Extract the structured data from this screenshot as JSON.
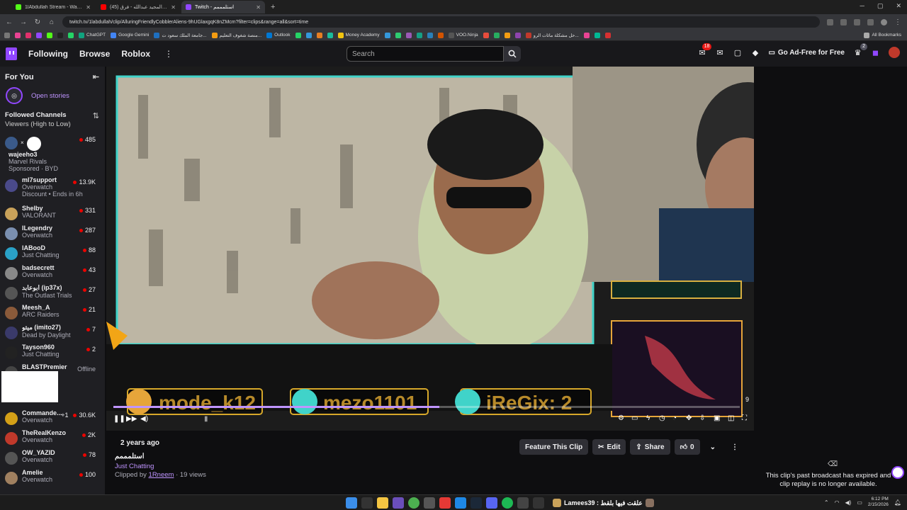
{
  "browser": {
    "tabs": [
      {
        "label": "1lAbdullah Stream - Watch Liv",
        "color": "#53fc18",
        "active": false
      },
      {
        "label": "عبدالمجيد عبدالله - فرق (45)",
        "color": "#ff0000",
        "active": false
      },
      {
        "label": "Twitch - استلمممم",
        "color": "#9147ff",
        "active": true
      }
    ],
    "new_tab": "+",
    "url": "twitch.tv/1labdullah/clip/AlluringFriendlyCobblerAliens-9hUGlaxgqK8nZMcm?filter=clips&range=all&sort=time",
    "bookmarks": [
      "ChatGPT",
      "Google Gemini",
      "جامعة الملك سعود ت...",
      "منصة شغوف التعليم...",
      "Outlook",
      "Money Academy",
      "VOO.Ninja",
      "حل مشكلة مائات الرو..."
    ],
    "all_bookmarks": "All Bookmarks"
  },
  "topnav": {
    "following": "Following",
    "browse": "Browse",
    "roblox": "Roblox",
    "more": "⋮",
    "search_placeholder": "Search",
    "notifications_count": "18",
    "crown_count": "2",
    "ad_free": "Go Ad-Free for Free"
  },
  "sidebar": {
    "for_you": "For You",
    "open_stories": "Open stories",
    "followed_title": "Followed Channels",
    "sort_label": "Viewers (High to Low)",
    "channels": [
      {
        "name": "ml7support",
        "game": "Overwatch",
        "viewers": "13.9K",
        "color": "#4a4a8a",
        "extra": "Discount • Ends in 6h"
      },
      {
        "name": "Shelby",
        "game": "VALORANT",
        "viewers": "331",
        "color": "#c9a25a"
      },
      {
        "name": "ILegendry",
        "game": "Overwatch",
        "viewers": "287",
        "color": "#7a8fb0"
      },
      {
        "name": "lABooD",
        "game": "Just Chatting",
        "viewers": "88",
        "color": "#2aa1c7"
      },
      {
        "name": "badsecrett",
        "game": "Overwatch",
        "viewers": "43",
        "color": "#888"
      },
      {
        "name": "ابوعابد (ip37x)",
        "game": "The Outlast Trials",
        "viewers": "27",
        "color": "#555"
      },
      {
        "name": "Meesh_A",
        "game": "ARC Raiders",
        "viewers": "21",
        "color": "#8a5a3a"
      },
      {
        "name": "ميتو (imito27)",
        "game": "Dead by Daylight",
        "viewers": "7",
        "color": "#3a3a6a"
      },
      {
        "name": "Tayson960",
        "game": "Just Chatting",
        "viewers": "2",
        "color": "#222"
      },
      {
        "name": "BLASTPremier",
        "game": "",
        "viewers": "Offline",
        "color": "#444"
      }
    ],
    "sponsored": {
      "name": "wajeeho3",
      "game": "Marvel Rivals",
      "sponsored_label": "Sponsored",
      "brand": "BYD",
      "viewers": "485"
    },
    "bottom_channels": [
      {
        "name": "Commande...",
        "extra": "+1",
        "game": "Overwatch",
        "viewers": "30.6K",
        "color": "#d4a017"
      },
      {
        "name": "TheRealKenzo",
        "game": "Overwatch",
        "viewers": "2K",
        "color": "#c0392b"
      },
      {
        "name": "OW_YAZID",
        "game": "Overwatch",
        "viewers": "78",
        "color": "#555"
      },
      {
        "name": "Amelie",
        "game": "Overwatch",
        "viewers": "100",
        "color": "#a08060"
      }
    ]
  },
  "video": {
    "overlay_names": [
      "mode_k12",
      "mezo1101",
      "iReGix: 2"
    ],
    "corner_number": "9",
    "progress_fraction": 0.52
  },
  "clip": {
    "age": "2 years ago",
    "title": "استلمممم",
    "category": "Just Chatting",
    "clipped_by_label": "Clipped by",
    "clipper": "1Rneem",
    "views": "· 19 views",
    "feature": "Feature This Clip",
    "edit": "Edit",
    "share": "Share",
    "likes": "0"
  },
  "right_panel": {
    "expired_text": "This clip's past broadcast has expired and clip replay is no longer available."
  },
  "taskbar": {
    "media_title": "Lamees39 : علقت فيها بلقط",
    "time": "6:12 PM",
    "date": "2/15/2026"
  }
}
